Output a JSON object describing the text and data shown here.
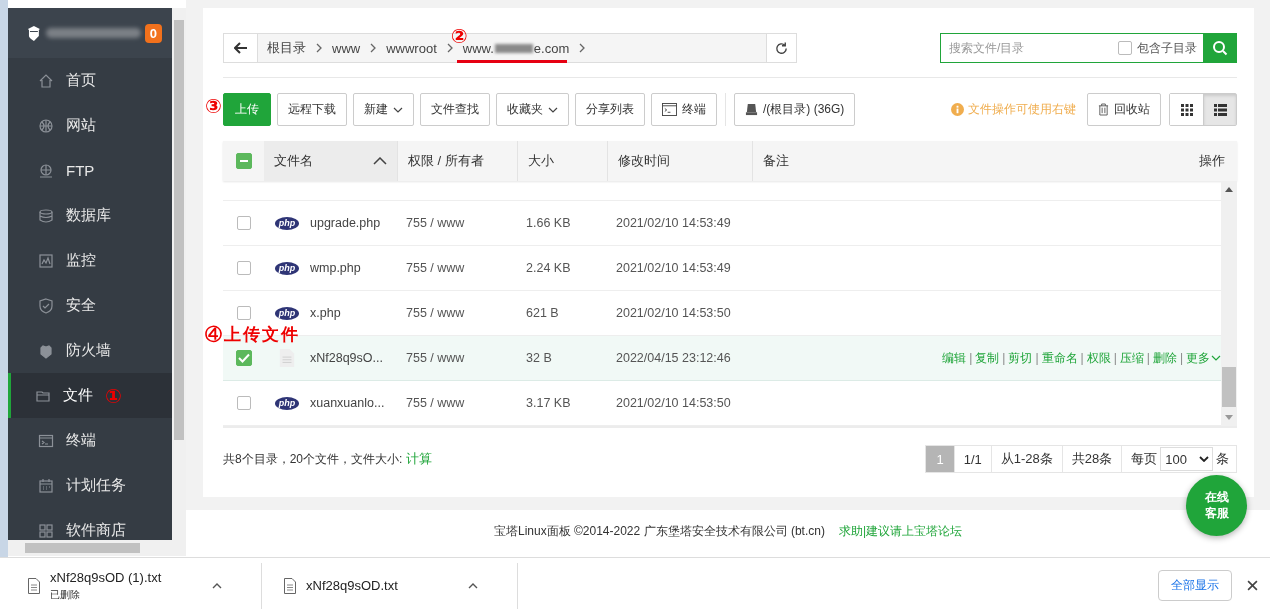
{
  "sidebar": {
    "badge": "0",
    "items": [
      {
        "label": "首页",
        "selected": false
      },
      {
        "label": "网站",
        "selected": false
      },
      {
        "label": "FTP",
        "selected": false
      },
      {
        "label": "数据库",
        "selected": false
      },
      {
        "label": "监控",
        "selected": false
      },
      {
        "label": "安全",
        "selected": false
      },
      {
        "label": "防火墙",
        "selected": false
      },
      {
        "label": "文件",
        "selected": true,
        "annotation": "①"
      },
      {
        "label": "终端",
        "selected": false
      },
      {
        "label": "计划任务",
        "selected": false
      },
      {
        "label": "软件商店",
        "selected": false
      }
    ]
  },
  "path_bar": {
    "crumbs": [
      {
        "label": "根目录"
      },
      {
        "label": "www"
      },
      {
        "label": "wwwroot"
      },
      {
        "label": "www.",
        "label_end": "e.com",
        "redacted": true,
        "annotation": "②",
        "underlined": true
      }
    ]
  },
  "search": {
    "placeholder": "搜索文件/目录",
    "include_subdirs": {
      "label": "包含子目录",
      "checked": false
    }
  },
  "toolbar": {
    "annotation": "③",
    "buttons": [
      {
        "label": "上传",
        "kind": "primary"
      },
      {
        "label": "远程下载",
        "kind": "plain"
      },
      {
        "label": "新建",
        "kind": "dropdown"
      },
      {
        "label": "文件查找",
        "kind": "plain"
      },
      {
        "label": "收藏夹",
        "kind": "dropdown"
      },
      {
        "label": "分享列表",
        "kind": "plain"
      },
      {
        "label": "终端",
        "kind": "terminal"
      },
      {
        "label": "/(根目录) (36G)",
        "kind": "disk"
      }
    ],
    "tip": "文件操作可使用右键",
    "recycle_bin": "回收站",
    "views": [
      {
        "kind": "grid",
        "selected": false
      },
      {
        "kind": "list",
        "selected": true
      }
    ]
  },
  "table": {
    "select_all": {
      "indeterminate": true
    },
    "columns": [
      {
        "label": "文件名",
        "sorted": true
      },
      {
        "label": "权限 / 所有者",
        "sorted": false
      },
      {
        "label": "大小",
        "sorted": false
      },
      {
        "label": "修改时间",
        "sorted": false
      },
      {
        "label": "备注",
        "sorted": false
      },
      {
        "label": "操作",
        "sorted": false
      }
    ],
    "rows": [
      {
        "kind": "php",
        "icon_label": "php",
        "name": "upgrade.php",
        "perms": "755 / www",
        "size": "1.66 KB",
        "modified": "2021/02/10 14:53:49",
        "selected": false,
        "checked": false
      },
      {
        "kind": "php",
        "icon_label": "php",
        "name": "wmp.php",
        "perms": "755 / www",
        "size": "2.24 KB",
        "modified": "2021/02/10 14:53:49",
        "selected": false,
        "checked": false
      },
      {
        "kind": "php",
        "icon_label": "php",
        "name": "x.php",
        "perms": "755 / www",
        "size": "621 B",
        "modified": "2021/02/10 14:53:50",
        "selected": false,
        "checked": false
      },
      {
        "kind": "text",
        "name": "xNf28q9sO...",
        "perms": "755 / www",
        "size": "32 B",
        "modified": "2022/04/15 23:12:46",
        "selected": true,
        "checked": true,
        "annotation": "④上传文件",
        "action_separator": "|",
        "actions": [
          "编辑",
          "复制",
          "剪切",
          "重命名",
          "权限",
          "压缩",
          "删除",
          "更多"
        ]
      },
      {
        "kind": "php",
        "icon_label": "php",
        "name": "xuanxuanlo...",
        "perms": "755 / www",
        "size": "3.17 KB",
        "modified": "2021/02/10 14:53:50",
        "selected": false,
        "checked": false
      }
    ]
  },
  "summary": {
    "text": "共8个目录，20个文件，文件大小: ",
    "link": "计算"
  },
  "pagination": {
    "current": "1",
    "pages": "1/1",
    "range": "从1-28条",
    "total": "共28条",
    "per_page_label": "每页",
    "per_page": "100",
    "unit": "条"
  },
  "chat_button": "在线客服",
  "footer": {
    "copyright": "宝塔Linux面板 ©2014-2022 广东堡塔安全技术有限公司 (bt.cn)",
    "link": "求助|建议请上宝塔论坛"
  },
  "downloads": {
    "items": [
      {
        "filename": "xNf28q9sOD (1).txt",
        "status": "已删除"
      },
      {
        "filename": "xNf28q9sOD.txt"
      }
    ],
    "show_all": "全部显示"
  }
}
